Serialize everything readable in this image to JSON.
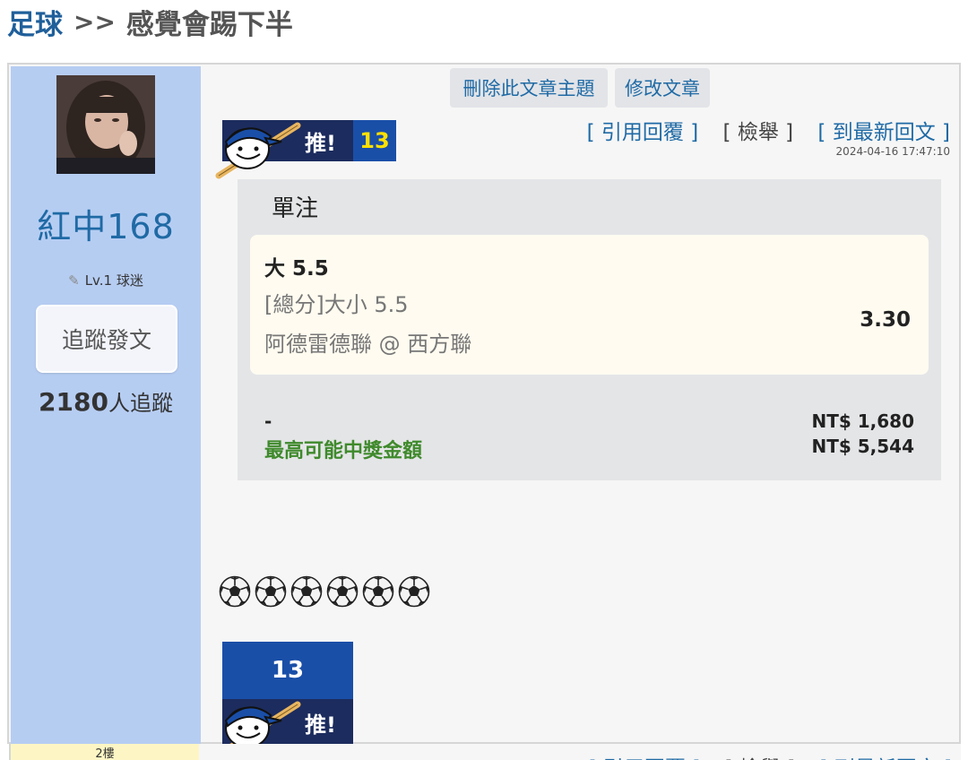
{
  "breadcrumb": {
    "category": "足球",
    "separator": ">>",
    "title": "感覺會踢下半"
  },
  "author": {
    "name": "紅中168",
    "level": "Lv.1 球迷",
    "follow_button": "追蹤發文",
    "followers_count": "2180",
    "followers_unit": "人追蹤"
  },
  "actions": {
    "delete_topic": "刪除此文章主題",
    "edit_post": "修改文章"
  },
  "push": {
    "label": "推!",
    "count": "13"
  },
  "reply_links": {
    "quote": "[ 引用回覆 ]",
    "report": "[ 檢舉 ]",
    "latest": "[ 到最新回文 ]"
  },
  "timestamp": "2024-04-16 17:47:10",
  "bet_slip": {
    "title": "單注",
    "pick": "大 5.5",
    "market": "[總分]大小 5.5",
    "match": "阿德雷德聯 @ 西方聯",
    "odds": "3.30",
    "dash": "-",
    "prize_label": "最高可能中獎金額",
    "stake": "NT$ 1,680",
    "payout": "NT$ 5,544"
  },
  "balls_text": "⚽⚽⚽⚽⚽⚽",
  "next_post": {
    "floor": "2樓"
  },
  "colors": {
    "author_bg": "#b6cdf2",
    "link": "#1f6aa5",
    "prize_green": "#3f8a2c",
    "push_count": "#ffe000"
  },
  "icons": {
    "mascot": "baseball-mascot-icon",
    "pen": "pen-icon",
    "ball": "soccer-ball-icon"
  }
}
